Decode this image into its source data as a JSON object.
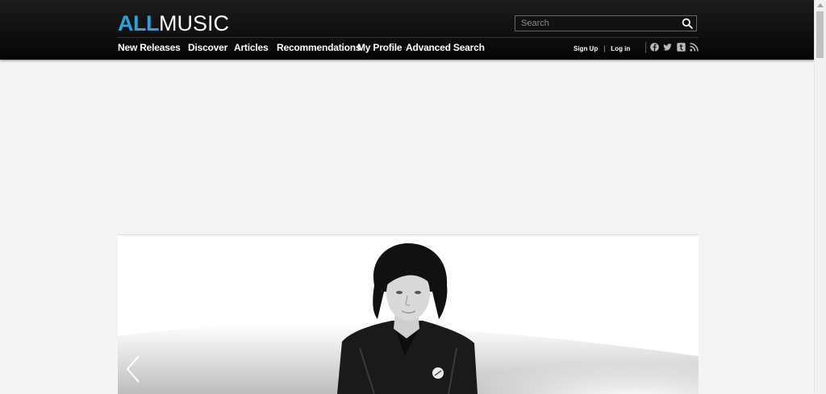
{
  "header": {
    "logo": {
      "part1": "ALL",
      "part2": "MUSIC"
    },
    "search": {
      "placeholder": "Search",
      "value": ""
    },
    "nav": [
      {
        "label": "New Releases"
      },
      {
        "label": "Discover"
      },
      {
        "label": "Articles"
      },
      {
        "label": "Recommendations"
      },
      {
        "label": "My Profile"
      },
      {
        "label": "Advanced Search"
      }
    ],
    "auth": {
      "signup": "Sign Up",
      "separator": "|",
      "login": "Log in"
    },
    "social_icons": [
      "facebook-icon",
      "twitter-icon",
      "tumblr-icon",
      "rss-icon"
    ]
  },
  "hero": {
    "prev_icon": "chevron-left-icon"
  },
  "colors": {
    "accent": "#29a3df",
    "header_bg": "#0a0a0a",
    "page_bg": "#f4f4f4"
  }
}
